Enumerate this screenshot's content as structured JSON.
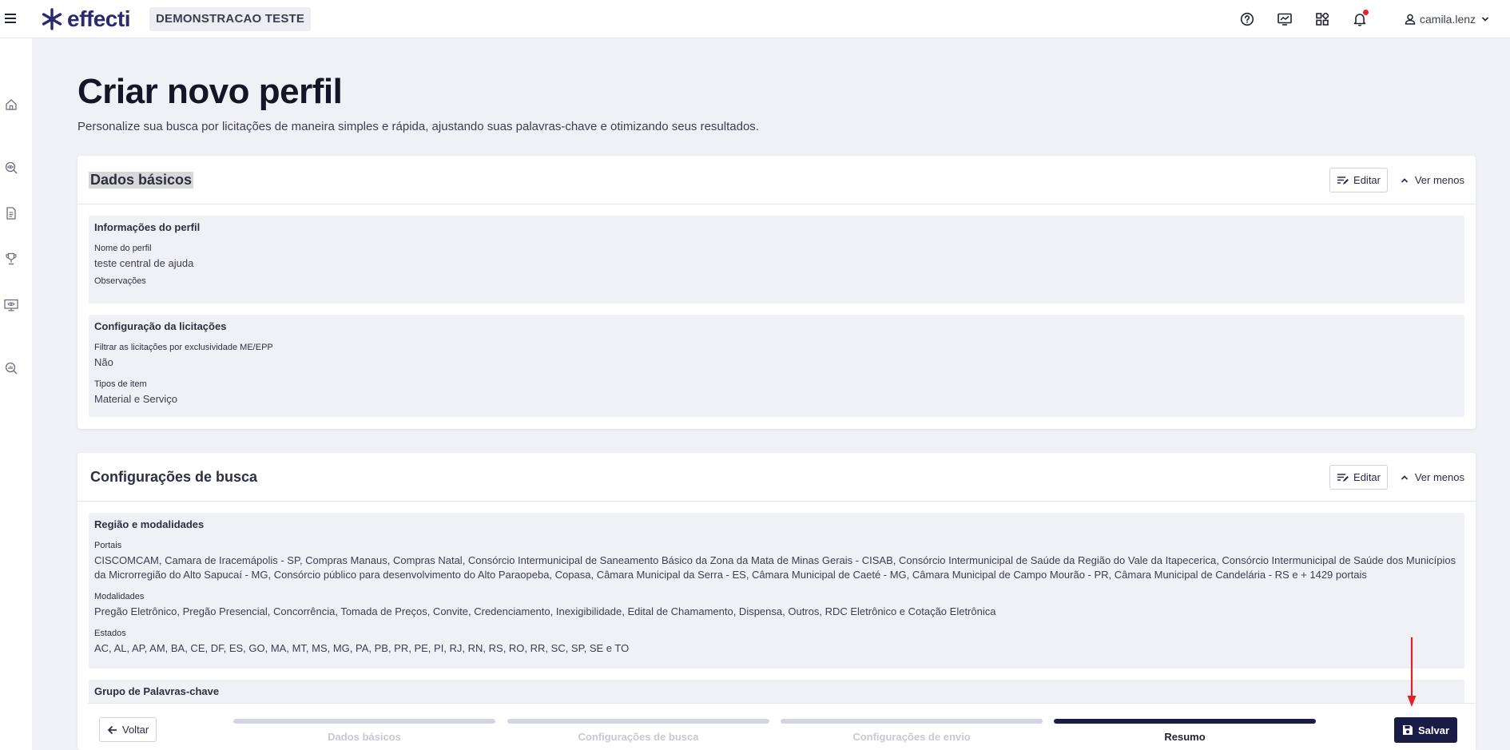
{
  "topbar": {
    "logo_text": "effecti",
    "company_name": "DEMONSTRACAO TESTE",
    "icons": [
      "help-icon",
      "monitor-chart-icon",
      "apps-icon",
      "bell-icon"
    ],
    "username": "camila.lenz"
  },
  "sidebar": {
    "icons": [
      "home-icon",
      "search-eye-icon",
      "document-icon",
      "trophy-icon",
      "monitor-eye-icon",
      "search-chart-icon"
    ]
  },
  "page": {
    "title": "Criar novo perfil",
    "description": "Personalize sua busca por licitações de maneira simples e rápida, ajustando suas palavras-chave e otimizando seus resultados."
  },
  "card_basic": {
    "title": "Dados básicos",
    "edit_label": "Editar",
    "less_label": "Ver menos",
    "sections": [
      {
        "title": "Informações do perfil",
        "fields": [
          {
            "label": "Nome do perfil",
            "value": "teste central de ajuda"
          },
          {
            "label": "Observações",
            "value": ""
          }
        ]
      },
      {
        "title": "Configuração da licitações",
        "fields": [
          {
            "label": "Filtrar as licitações por exclusividade ME/EPP",
            "value": "Não"
          },
          {
            "label": "Tipos de item",
            "value": "Material e Serviço"
          }
        ]
      }
    ]
  },
  "card_search": {
    "title": "Configurações de busca",
    "edit_label": "Editar",
    "less_label": "Ver menos",
    "sections": [
      {
        "title": "Região e modalidades",
        "fields": [
          {
            "label": "Portais",
            "value": "CISCOMCAM, Camara de Iracemápolis - SP, Compras Manaus, Compras Natal, Consórcio Intermunicipal de Saneamento Básico da Zona da Mata de Minas Gerais - CISAB, Consórcio Intermunicipal de Saúde da Região do Vale da Itapecerica, Consórcio Intermunicipal de Saúde dos Municípios da Microrregião do Alto Sapucaí - MG, Consórcio público para desenvolvimento do Alto Paraopeba, Copasa, Câmara Municipal da Serra - ES, Câmara Municipal de Caeté - MG, Câmara Municipal de Campo Mourão - PR, Câmara Municipal de Candelária - RS e + 1429 portais"
          },
          {
            "label": "Modalidades",
            "value": "Pregão Eletrônico, Pregão Presencial, Concorrência, Tomada de Preços, Convite, Credenciamento, Inexigibilidade, Edital de Chamamento, Dispensa, Outros, RDC Eletrônico e Cotação Eletrônica"
          },
          {
            "label": "Estados",
            "value": "AC, AL, AP, AM, BA, CE, DF, ES, GO, MA, MT, MS, MG, PA, PB, PR, PE, PI, RJ, RN, RS, RO, RR, SC, SP, SE e TO"
          }
        ]
      },
      {
        "title": "Grupo de Palavras-chave"
      }
    ]
  },
  "footer": {
    "back_label": "Voltar",
    "save_label": "Salvar",
    "steps": [
      {
        "label": "Dados básicos",
        "active": false
      },
      {
        "label": "Configurações de busca",
        "active": false
      },
      {
        "label": "Configurações de envio",
        "active": false
      },
      {
        "label": "Resumo",
        "active": true
      }
    ]
  },
  "colors": {
    "brand": "#2a2b6f",
    "primary_dark": "#1a1b47",
    "background": "#f0f1f6",
    "notification": "#e3232a",
    "annotation_arrow": "#e3232a"
  }
}
